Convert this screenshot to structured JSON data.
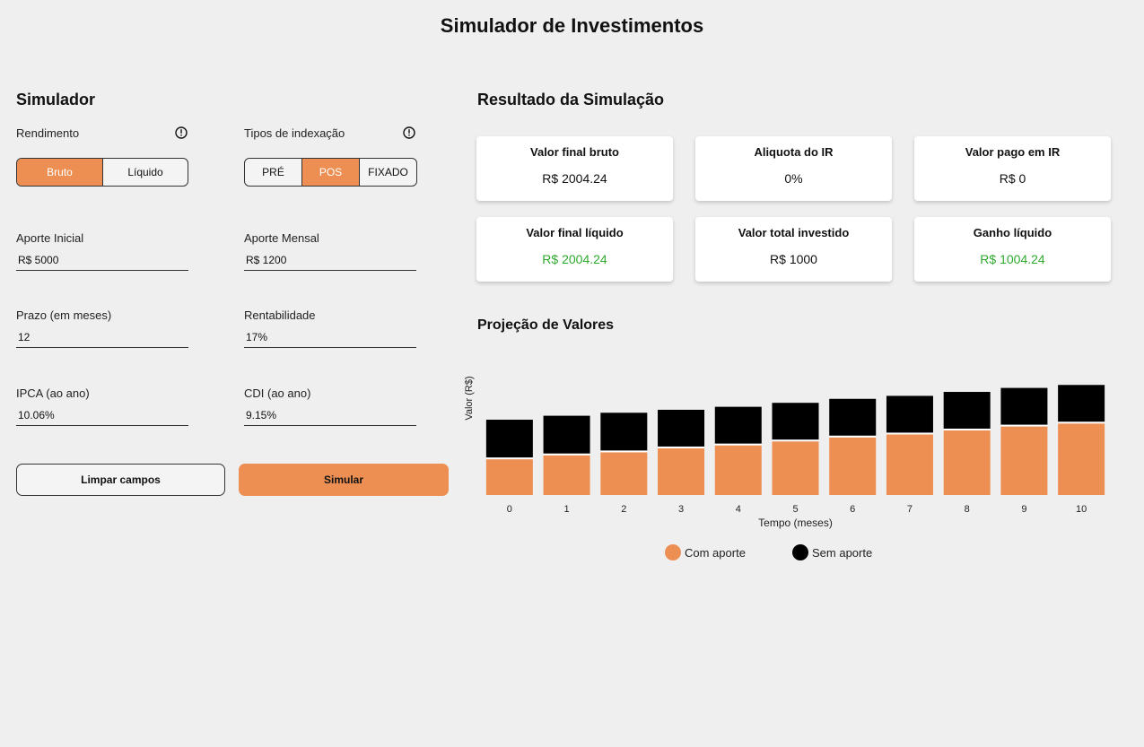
{
  "page": {
    "title": "Simulador de Investimentos"
  },
  "simulator": {
    "title": "Simulador",
    "rendimento": {
      "label": "Rendimento",
      "options": [
        "Bruto",
        "Líquido"
      ],
      "selected": "Bruto"
    },
    "indexacao": {
      "label": "Tipos de indexação",
      "options": [
        "PRÉ",
        "POS",
        "FIXADO"
      ],
      "selected": "POS"
    },
    "fields": {
      "aporte_inicial": {
        "label": "Aporte Inicial",
        "value": "R$ 5000"
      },
      "aporte_mensal": {
        "label": "Aporte Mensal",
        "value": "R$ 1200"
      },
      "prazo": {
        "label": "Prazo (em meses)",
        "value": "12"
      },
      "rentabilidade": {
        "label": "Rentabilidade",
        "value": "17%"
      },
      "ipca": {
        "label": "IPCA (ao ano)",
        "value": "10.06%"
      },
      "cdi": {
        "label": "CDI (ao ano)",
        "value": "9.15%"
      }
    },
    "buttons": {
      "clear": "Limpar campos",
      "simulate": "Simular"
    }
  },
  "result": {
    "title": "Resultado da Simulação",
    "cards": [
      {
        "title": "Valor final bruto",
        "value": "R$ 2004.24",
        "highlight": false
      },
      {
        "title": "Aliquota do IR",
        "value": "0%",
        "highlight": false
      },
      {
        "title": "Valor pago em IR",
        "value": "R$ 0",
        "highlight": false
      },
      {
        "title": "Valor final líquido",
        "value": "R$ 2004.24",
        "highlight": true
      },
      {
        "title": "Valor total investido",
        "value": "R$ 1000",
        "highlight": false
      },
      {
        "title": "Ganho líquido",
        "value": "R$ 1004.24",
        "highlight": true
      }
    ]
  },
  "projection": {
    "title": "Projeção de Valores"
  },
  "colors": {
    "accent": "#ed8f52",
    "positive": "#2eaa2e",
    "dark": "#000000"
  },
  "chart_data": {
    "type": "bar",
    "stacked": true,
    "xlabel": "Tempo (meses)",
    "ylabel": "Valor (R$)",
    "categories": [
      "0",
      "1",
      "2",
      "3",
      "4",
      "5",
      "6",
      "7",
      "8",
      "9",
      "10"
    ],
    "series": [
      {
        "name": "Com aporte",
        "color": "#ed8f52",
        "values": [
          36,
          40,
          43,
          47,
          50,
          54,
          58,
          61,
          65,
          69,
          72
        ]
      },
      {
        "name": "Sem aporte",
        "color": "#000000",
        "values": [
          38,
          38,
          38,
          37,
          37,
          37,
          37,
          37,
          37,
          37,
          37
        ]
      }
    ],
    "ylim": [
      0,
      130
    ],
    "grid": false,
    "legend": "bottom"
  }
}
